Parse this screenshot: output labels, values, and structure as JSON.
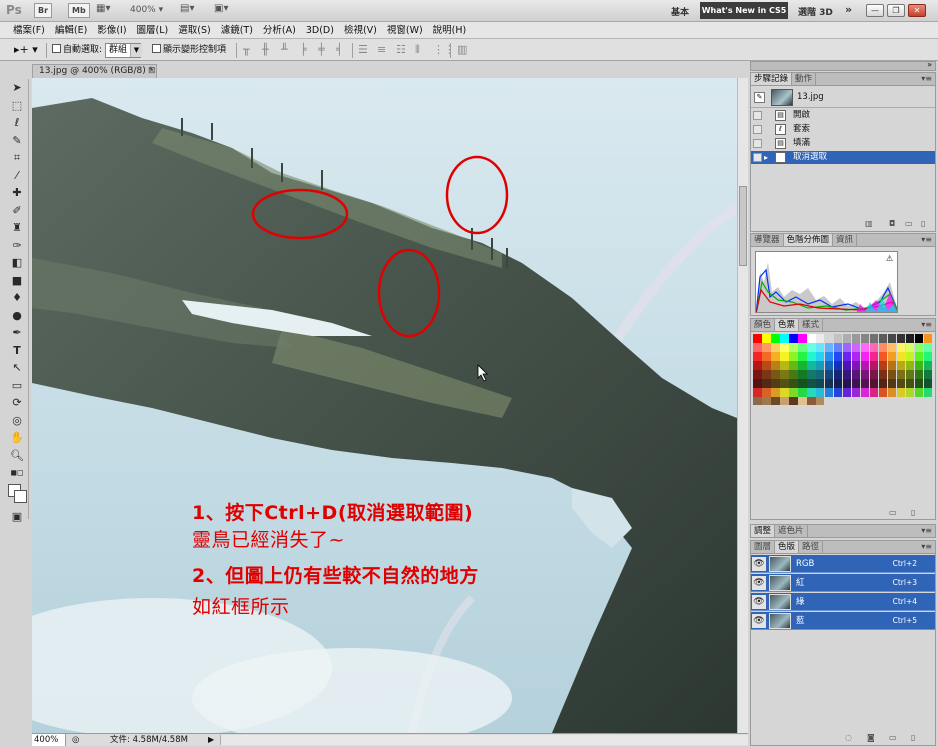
{
  "appbar": {
    "logo": "Ps",
    "bridge_label": "Br",
    "minibridge_label": "Mb",
    "zoom": "400%",
    "workspace_basic": "基本",
    "workspace_new": "What's New in CS5",
    "workspace_3d": "選階 3D",
    "more": "»"
  },
  "menu": [
    "檔案(F)",
    "編輯(E)",
    "影像(I)",
    "圖層(L)",
    "選取(S)",
    "濾鏡(T)",
    "分析(A)",
    "3D(D)",
    "檢視(V)",
    "視窗(W)",
    "說明(H)"
  ],
  "options": {
    "auto_select_label": "自動選取:",
    "auto_select_value": "群組",
    "show_transform_label": "顯示變形控制項"
  },
  "document": {
    "tab_title": "13.jpg @ 400% (RGB/8) *",
    "status_zoom": "400%",
    "status_doc": "文件: 4.58M/4.58M"
  },
  "annotation": {
    "line1": "1、按下Ctrl+D(取消選取範圍)",
    "line2": "靈鳥已經消失了~",
    "line3": "2、但圖上仍有些較不自然的地方",
    "line4": "如紅框所示",
    "color": "#e00000"
  },
  "history_panel": {
    "tabs": [
      "步驟記錄",
      "動作"
    ],
    "snapshot": "13.jpg",
    "steps": [
      "開啟",
      "套索",
      "填滿",
      "取消選取"
    ],
    "selected_step": "取消選取"
  },
  "histogram_panel": {
    "tabs": [
      "導覽器",
      "色階分佈圖",
      "資訊"
    ],
    "warning": "⚠"
  },
  "color_panel": {
    "tabs": [
      "顏色",
      "色票",
      "樣式"
    ]
  },
  "adjust_panel": {
    "tabs": [
      "調整",
      "遮色片"
    ]
  },
  "channels_panel": {
    "tabs": [
      "圖層",
      "色版",
      "路徑"
    ],
    "channels": [
      {
        "name": "RGB",
        "shortcut": "Ctrl+2"
      },
      {
        "name": "紅",
        "shortcut": "Ctrl+3"
      },
      {
        "name": "綠",
        "shortcut": "Ctrl+4"
      },
      {
        "name": "藍",
        "shortcut": "Ctrl+5"
      }
    ]
  },
  "tools": [
    "move-tool",
    "marquee-tool",
    "lasso-tool",
    "quick-select-tool",
    "crop-tool",
    "eyedropper-tool",
    "healing-brush-tool",
    "brush-tool",
    "clone-stamp-tool",
    "history-brush-tool",
    "eraser-tool",
    "gradient-tool",
    "blur-tool",
    "dodge-tool",
    "pen-tool",
    "type-tool",
    "path-select-tool",
    "shape-tool",
    "3d-rotate-tool",
    "3d-orbit-tool",
    "hand-tool",
    "zoom-tool"
  ]
}
